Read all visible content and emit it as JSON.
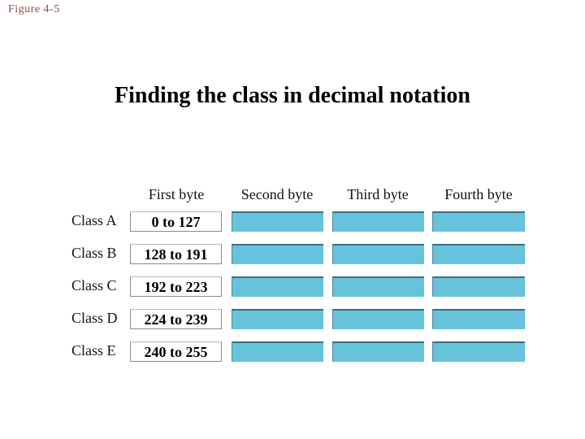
{
  "figure_label": "Figure 4-5",
  "title": "Finding the class in decimal notation",
  "columns": [
    "First byte",
    "Second byte",
    "Third byte",
    "Fourth byte"
  ],
  "rows": [
    {
      "label": "Class A",
      "first_byte": "0 to 127"
    },
    {
      "label": "Class B",
      "first_byte": "128 to 191"
    },
    {
      "label": "Class C",
      "first_byte": "192 to 223"
    },
    {
      "label": "Class D",
      "first_byte": "224 to 239"
    },
    {
      "label": "Class E",
      "first_byte": "240 to 255"
    }
  ],
  "colors": {
    "byte_cell": "#67c2dc",
    "figure_label": "#8b4a4a"
  }
}
